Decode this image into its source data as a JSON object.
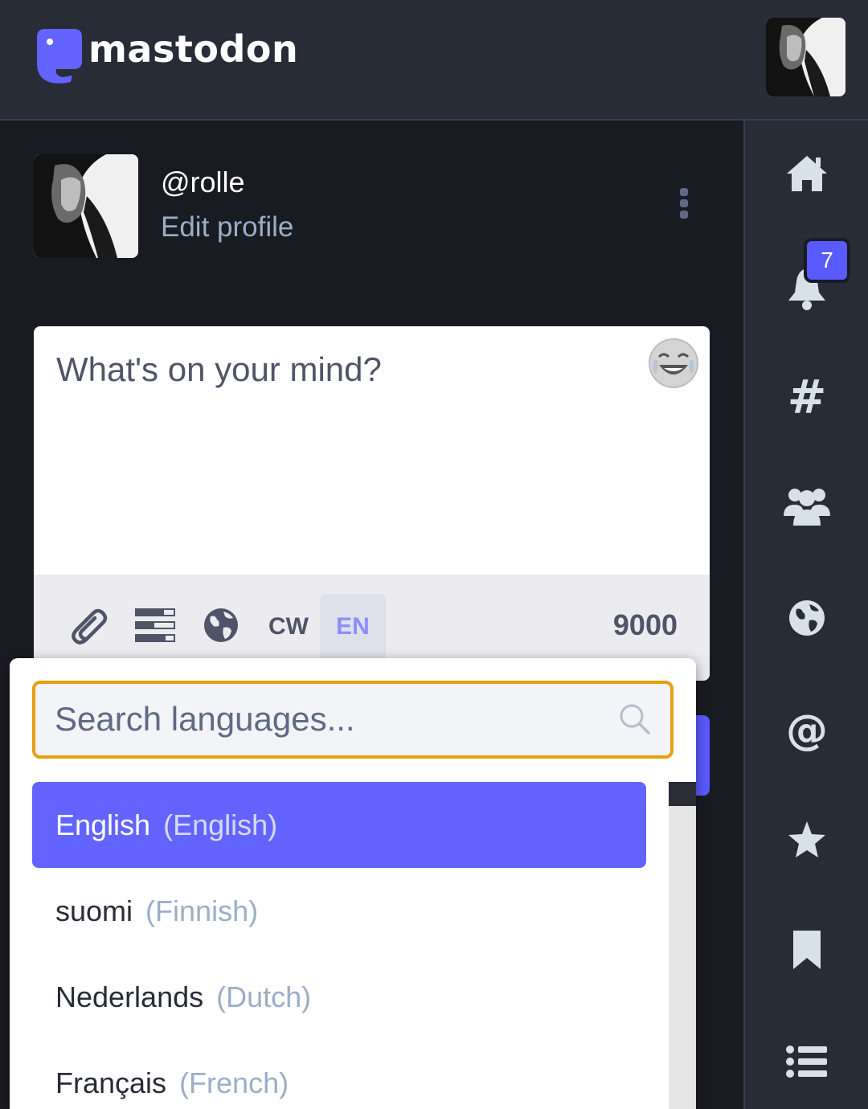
{
  "header": {
    "logo_text": "mastodon"
  },
  "profile": {
    "handle": "@rolle",
    "edit_label": "Edit profile"
  },
  "composer": {
    "placeholder": "What's on your mind?",
    "cw_label": "CW",
    "language_button": "EN",
    "char_count": "9000"
  },
  "language_picker": {
    "search_placeholder": "Search languages...",
    "items": [
      {
        "native": "English",
        "english": "(English)",
        "selected": true
      },
      {
        "native": "suomi",
        "english": "(Finnish)",
        "selected": false
      },
      {
        "native": "Nederlands",
        "english": "(Dutch)",
        "selected": false
      },
      {
        "native": "Français",
        "english": "(French)",
        "selected": false
      }
    ]
  },
  "nav": {
    "items": [
      "home-icon",
      "bell-icon",
      "hashtag-icon",
      "users-icon",
      "globe-icon",
      "at-icon",
      "star-icon",
      "bookmark-icon",
      "list-icon"
    ],
    "notification_count": "7"
  },
  "colors": {
    "accent": "#6364ff",
    "focus_ring": "#e8a010",
    "dark_bg": "#191b22",
    "panel_bg": "#282c37"
  }
}
